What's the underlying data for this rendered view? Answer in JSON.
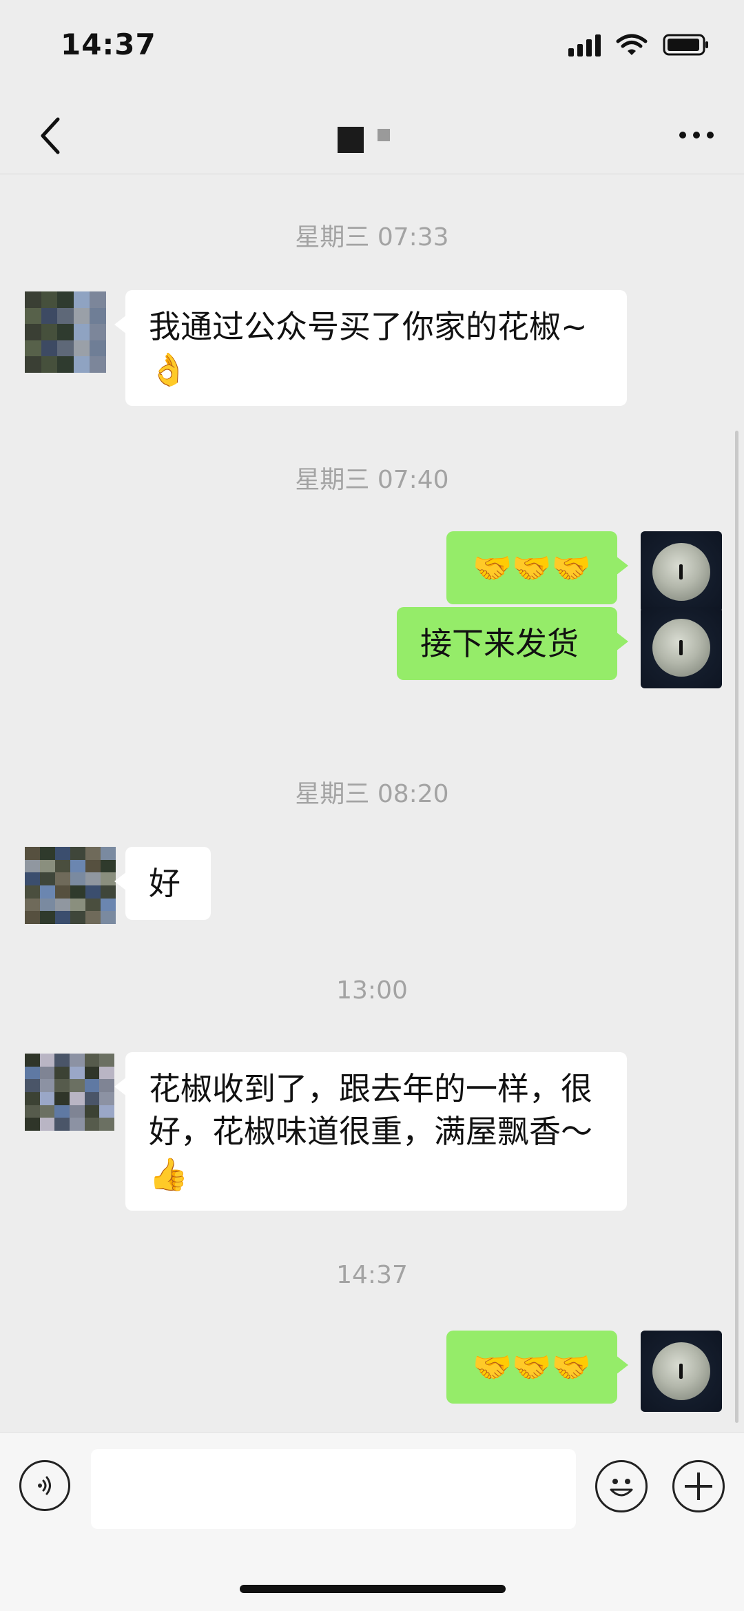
{
  "status_bar": {
    "time": "14:37",
    "signal_icon": "cellular-signal-icon",
    "wifi_icon": "wifi-icon",
    "battery_icon": "battery-icon"
  },
  "nav": {
    "back_icon": "chevron-left-icon",
    "title_icon": "pixelated-contact-name",
    "more_icon": "more-dots-icon"
  },
  "messages": [
    {
      "kind": "timestamp",
      "text": "星期三 07:33"
    },
    {
      "kind": "received",
      "text": "我通过公众号买了你家的花椒~👌"
    },
    {
      "kind": "timestamp",
      "text": "星期三 07:40"
    },
    {
      "kind": "sent",
      "text": "🤝🤝🤝"
    },
    {
      "kind": "sent",
      "text": "接下来发货"
    },
    {
      "kind": "timestamp",
      "text": "星期三 08:20"
    },
    {
      "kind": "received",
      "text": "好"
    },
    {
      "kind": "timestamp",
      "text": "13:00"
    },
    {
      "kind": "received",
      "text": "花椒收到了，跟去年的一样，很好，花椒味道很重，满屋飘香～👍"
    },
    {
      "kind": "timestamp",
      "text": "14:37"
    },
    {
      "kind": "sent",
      "text": "🤝🤝🤝"
    }
  ],
  "avatars": {
    "received_icon": "pixelated-avatar",
    "sent_icon": "moon-avatar"
  },
  "input_bar": {
    "voice_icon": "voice-icon",
    "input_value": "",
    "emoji_icon": "emoji-icon",
    "plus_icon": "plus-icon"
  },
  "colors": {
    "background": "#ededed",
    "sent_bubble": "#95ec69",
    "received_bubble": "#ffffff",
    "timestamp": "#a3a3a3"
  }
}
